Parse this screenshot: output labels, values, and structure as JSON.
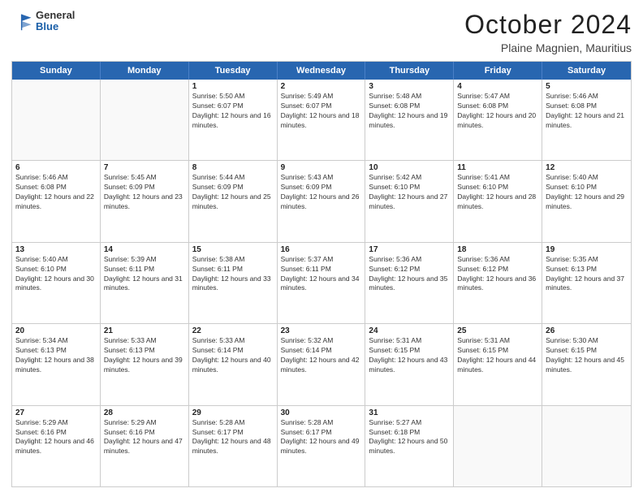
{
  "header": {
    "logo_general": "General",
    "logo_blue": "Blue",
    "month_title": "October 2024",
    "location": "Plaine Magnien, Mauritius"
  },
  "days_of_week": [
    "Sunday",
    "Monday",
    "Tuesday",
    "Wednesday",
    "Thursday",
    "Friday",
    "Saturday"
  ],
  "weeks": [
    [
      {
        "day": "",
        "sunrise": "",
        "sunset": "",
        "daylight": "",
        "empty": true
      },
      {
        "day": "",
        "sunrise": "",
        "sunset": "",
        "daylight": "",
        "empty": true
      },
      {
        "day": "1",
        "sunrise": "Sunrise: 5:50 AM",
        "sunset": "Sunset: 6:07 PM",
        "daylight": "Daylight: 12 hours and 16 minutes."
      },
      {
        "day": "2",
        "sunrise": "Sunrise: 5:49 AM",
        "sunset": "Sunset: 6:07 PM",
        "daylight": "Daylight: 12 hours and 18 minutes."
      },
      {
        "day": "3",
        "sunrise": "Sunrise: 5:48 AM",
        "sunset": "Sunset: 6:08 PM",
        "daylight": "Daylight: 12 hours and 19 minutes."
      },
      {
        "day": "4",
        "sunrise": "Sunrise: 5:47 AM",
        "sunset": "Sunset: 6:08 PM",
        "daylight": "Daylight: 12 hours and 20 minutes."
      },
      {
        "day": "5",
        "sunrise": "Sunrise: 5:46 AM",
        "sunset": "Sunset: 6:08 PM",
        "daylight": "Daylight: 12 hours and 21 minutes."
      }
    ],
    [
      {
        "day": "6",
        "sunrise": "Sunrise: 5:46 AM",
        "sunset": "Sunset: 6:08 PM",
        "daylight": "Daylight: 12 hours and 22 minutes."
      },
      {
        "day": "7",
        "sunrise": "Sunrise: 5:45 AM",
        "sunset": "Sunset: 6:09 PM",
        "daylight": "Daylight: 12 hours and 23 minutes."
      },
      {
        "day": "8",
        "sunrise": "Sunrise: 5:44 AM",
        "sunset": "Sunset: 6:09 PM",
        "daylight": "Daylight: 12 hours and 25 minutes."
      },
      {
        "day": "9",
        "sunrise": "Sunrise: 5:43 AM",
        "sunset": "Sunset: 6:09 PM",
        "daylight": "Daylight: 12 hours and 26 minutes."
      },
      {
        "day": "10",
        "sunrise": "Sunrise: 5:42 AM",
        "sunset": "Sunset: 6:10 PM",
        "daylight": "Daylight: 12 hours and 27 minutes."
      },
      {
        "day": "11",
        "sunrise": "Sunrise: 5:41 AM",
        "sunset": "Sunset: 6:10 PM",
        "daylight": "Daylight: 12 hours and 28 minutes."
      },
      {
        "day": "12",
        "sunrise": "Sunrise: 5:40 AM",
        "sunset": "Sunset: 6:10 PM",
        "daylight": "Daylight: 12 hours and 29 minutes."
      }
    ],
    [
      {
        "day": "13",
        "sunrise": "Sunrise: 5:40 AM",
        "sunset": "Sunset: 6:10 PM",
        "daylight": "Daylight: 12 hours and 30 minutes."
      },
      {
        "day": "14",
        "sunrise": "Sunrise: 5:39 AM",
        "sunset": "Sunset: 6:11 PM",
        "daylight": "Daylight: 12 hours and 31 minutes."
      },
      {
        "day": "15",
        "sunrise": "Sunrise: 5:38 AM",
        "sunset": "Sunset: 6:11 PM",
        "daylight": "Daylight: 12 hours and 33 minutes."
      },
      {
        "day": "16",
        "sunrise": "Sunrise: 5:37 AM",
        "sunset": "Sunset: 6:11 PM",
        "daylight": "Daylight: 12 hours and 34 minutes."
      },
      {
        "day": "17",
        "sunrise": "Sunrise: 5:36 AM",
        "sunset": "Sunset: 6:12 PM",
        "daylight": "Daylight: 12 hours and 35 minutes."
      },
      {
        "day": "18",
        "sunrise": "Sunrise: 5:36 AM",
        "sunset": "Sunset: 6:12 PM",
        "daylight": "Daylight: 12 hours and 36 minutes."
      },
      {
        "day": "19",
        "sunrise": "Sunrise: 5:35 AM",
        "sunset": "Sunset: 6:13 PM",
        "daylight": "Daylight: 12 hours and 37 minutes."
      }
    ],
    [
      {
        "day": "20",
        "sunrise": "Sunrise: 5:34 AM",
        "sunset": "Sunset: 6:13 PM",
        "daylight": "Daylight: 12 hours and 38 minutes."
      },
      {
        "day": "21",
        "sunrise": "Sunrise: 5:33 AM",
        "sunset": "Sunset: 6:13 PM",
        "daylight": "Daylight: 12 hours and 39 minutes."
      },
      {
        "day": "22",
        "sunrise": "Sunrise: 5:33 AM",
        "sunset": "Sunset: 6:14 PM",
        "daylight": "Daylight: 12 hours and 40 minutes."
      },
      {
        "day": "23",
        "sunrise": "Sunrise: 5:32 AM",
        "sunset": "Sunset: 6:14 PM",
        "daylight": "Daylight: 12 hours and 42 minutes."
      },
      {
        "day": "24",
        "sunrise": "Sunrise: 5:31 AM",
        "sunset": "Sunset: 6:15 PM",
        "daylight": "Daylight: 12 hours and 43 minutes."
      },
      {
        "day": "25",
        "sunrise": "Sunrise: 5:31 AM",
        "sunset": "Sunset: 6:15 PM",
        "daylight": "Daylight: 12 hours and 44 minutes."
      },
      {
        "day": "26",
        "sunrise": "Sunrise: 5:30 AM",
        "sunset": "Sunset: 6:15 PM",
        "daylight": "Daylight: 12 hours and 45 minutes."
      }
    ],
    [
      {
        "day": "27",
        "sunrise": "Sunrise: 5:29 AM",
        "sunset": "Sunset: 6:16 PM",
        "daylight": "Daylight: 12 hours and 46 minutes."
      },
      {
        "day": "28",
        "sunrise": "Sunrise: 5:29 AM",
        "sunset": "Sunset: 6:16 PM",
        "daylight": "Daylight: 12 hours and 47 minutes."
      },
      {
        "day": "29",
        "sunrise": "Sunrise: 5:28 AM",
        "sunset": "Sunset: 6:17 PM",
        "daylight": "Daylight: 12 hours and 48 minutes."
      },
      {
        "day": "30",
        "sunrise": "Sunrise: 5:28 AM",
        "sunset": "Sunset: 6:17 PM",
        "daylight": "Daylight: 12 hours and 49 minutes."
      },
      {
        "day": "31",
        "sunrise": "Sunrise: 5:27 AM",
        "sunset": "Sunset: 6:18 PM",
        "daylight": "Daylight: 12 hours and 50 minutes."
      },
      {
        "day": "",
        "sunrise": "",
        "sunset": "",
        "daylight": "",
        "empty": true
      },
      {
        "day": "",
        "sunrise": "",
        "sunset": "",
        "daylight": "",
        "empty": true
      }
    ]
  ]
}
